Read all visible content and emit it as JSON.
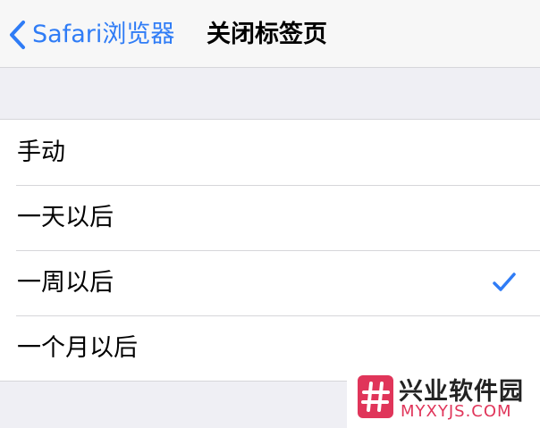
{
  "navbar": {
    "back_label": "Safari浏览器",
    "title": "关闭标签页"
  },
  "options": [
    {
      "label": "手动",
      "selected": false
    },
    {
      "label": "一天以后",
      "selected": false
    },
    {
      "label": "一周以后",
      "selected": true
    },
    {
      "label": "一个月以后",
      "selected": false
    }
  ],
  "watermark": {
    "name": "兴业软件园",
    "domain": "MYXYJS.COM"
  },
  "colors": {
    "accent": "#2f7cf6",
    "background": "#efeff4",
    "watermark_red": "#e0355a"
  },
  "icons": {
    "back": "chevron-left-icon",
    "selected": "checkmark-icon",
    "watermark_logo": "hash-logo-icon"
  }
}
